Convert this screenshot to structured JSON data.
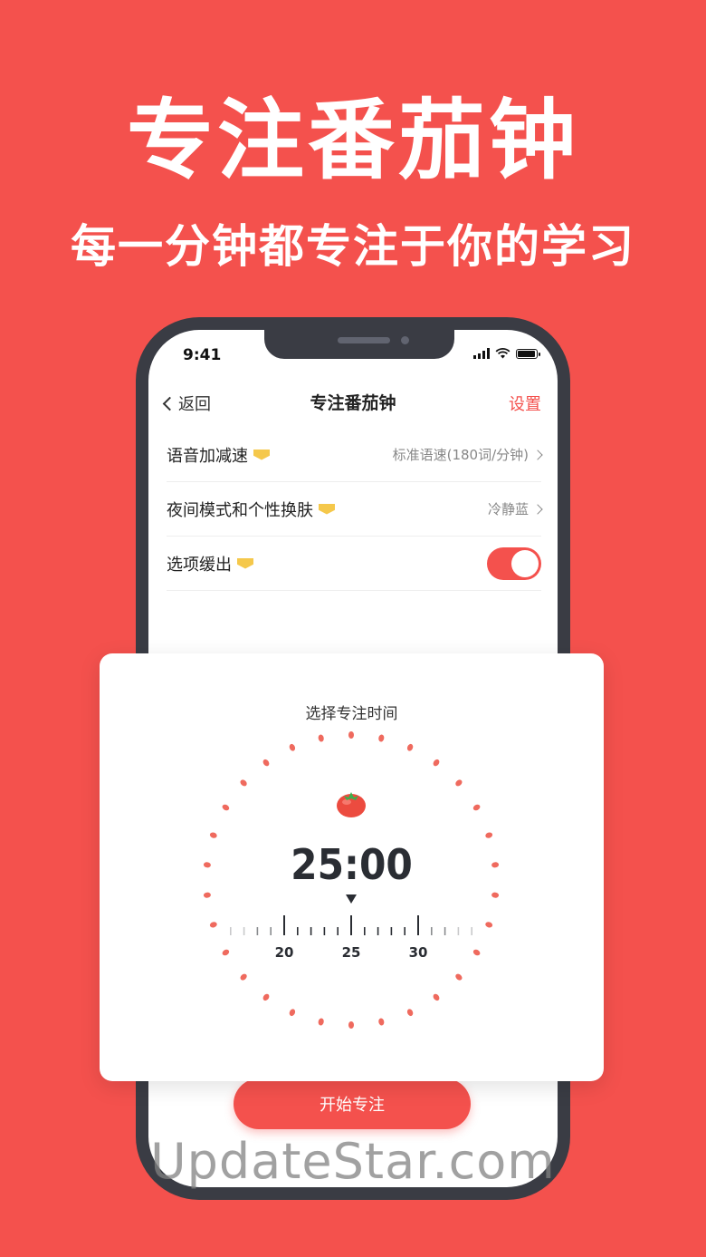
{
  "hero": {
    "title": "专注番茄钟",
    "subtitle": "每一分钟都专注于你的学习"
  },
  "status_bar": {
    "time": "9:41"
  },
  "navbar": {
    "back_label": "返回",
    "title": "专注番茄钟",
    "settings_label": "设置"
  },
  "settings": [
    {
      "label": "语音加减速",
      "value": "标准语速(180词/分钟)"
    },
    {
      "label": "夜间模式和个性换肤",
      "value": "冷静蓝"
    },
    {
      "label": "选项缓出",
      "toggle_on": true
    }
  ],
  "timer_card": {
    "title": "选择专注时间",
    "time": "25:00",
    "ruler_labels": [
      "20",
      "25",
      "30"
    ],
    "selected_minutes": 25
  },
  "start_button": "开始专注",
  "watermark": "UpdateStar.com",
  "colors": {
    "brand": "#f4514d",
    "vip_badge": "#f5c84b"
  }
}
